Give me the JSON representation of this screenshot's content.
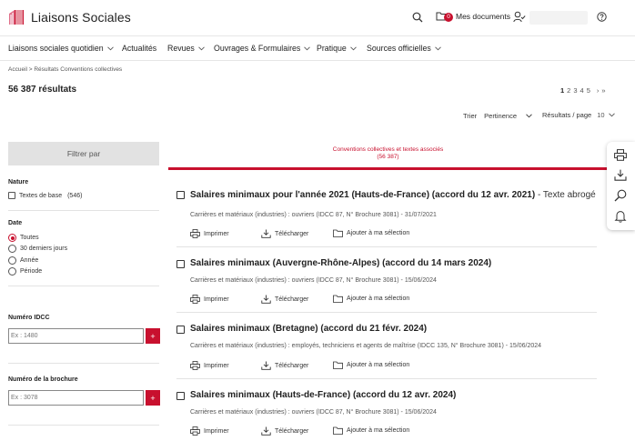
{
  "brand": {
    "name": "Liaisons Sociales",
    "accent": "#c8102e"
  },
  "header": {
    "search_icon": "search-icon",
    "docs_count": "0",
    "docs_label": "Mes documents",
    "help_icon": "help-icon"
  },
  "nav": {
    "items": [
      {
        "label": "Liaisons sociales quotidien",
        "dropdown": true
      },
      {
        "label": "Actualités",
        "dropdown": false
      },
      {
        "label": "Revues",
        "dropdown": true
      },
      {
        "label": "Ouvrages & Formulaires",
        "dropdown": true
      },
      {
        "label": "Pratique",
        "dropdown": true
      },
      {
        "label": "Sources officielles",
        "dropdown": true
      }
    ]
  },
  "breadcrumb": "Accueil > Résultats Conventions collectives",
  "results_count": "56 387 résultats",
  "pager": {
    "pages": [
      "1",
      "2",
      "3",
      "4",
      "5"
    ],
    "current": "1",
    "next": "›",
    "last": "»"
  },
  "sort": {
    "label": "Trier",
    "value": "Pertinence"
  },
  "per_page": {
    "label": "Résultats / page",
    "value": "10"
  },
  "sidebar": {
    "filter_button": "Filtrer par",
    "nature": {
      "title": "Nature",
      "option": "Textes de base",
      "count": "(546)"
    },
    "date": {
      "title": "Date",
      "options": [
        "Toutes",
        "30 derniers jours",
        "Année",
        "Période"
      ],
      "selected": "Toutes"
    },
    "idcc": {
      "title": "Numéro IDCC",
      "placeholder": "Ex : 1480",
      "add": "+"
    },
    "brochure": {
      "title": "Numéro de la brochure",
      "placeholder": "Ex : 3078",
      "add": "+"
    }
  },
  "tab": {
    "line1": "Conventions collectives et textes associés",
    "line2": "(56 387)"
  },
  "actions": {
    "print": "Imprimer",
    "download": "Télécharger",
    "add": "Ajouter à ma sélection"
  },
  "results": [
    {
      "title": "Salaires minimaux pour l'année 2021 (Hauts-de-France) (accord du 12 avr. 2021)",
      "suffix": " - Texte abrogé",
      "meta": "Carrières et matériaux (industries) : ouvriers (IDCC 87, N° Brochure 3081) - 31/07/2021"
    },
    {
      "title": "Salaires minimaux (Auvergne-Rhône-Alpes) (accord du 14 mars 2024)",
      "suffix": "",
      "meta": "Carrières et matériaux (industries) : ouvriers (IDCC 87, N° Brochure 3081) - 15/06/2024"
    },
    {
      "title": "Salaires minimaux (Bretagne) (accord du 21 févr. 2024)",
      "suffix": "",
      "meta": "Carrières et matériaux (industries) : employés, techniciens et agents de maîtrise (IDCC 135, N° Brochure 3081) - 15/06/2024"
    },
    {
      "title": "Salaires minimaux (Hauts-de-France) (accord du 12 avr. 2024)",
      "suffix": "",
      "meta": "Carrières et matériaux (industries) : ouvriers (IDCC 87, N° Brochure 3081) - 15/06/2024"
    }
  ],
  "floating_toolbar": [
    "print-icon",
    "download-icon",
    "search-doc-icon",
    "bell-icon"
  ]
}
